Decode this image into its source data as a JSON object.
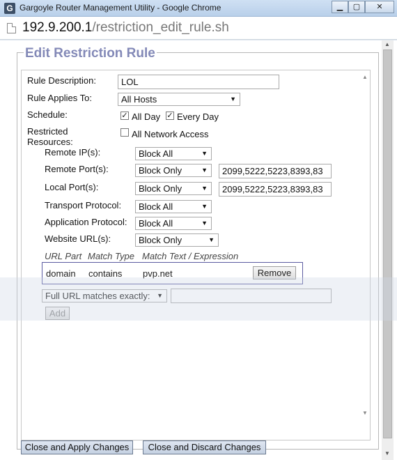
{
  "window": {
    "title": "Gargoyle Router Management Utility - Google Chrome",
    "app_icon": "G",
    "minimize_glyph": "▁",
    "maximize_glyph": "▢",
    "close_glyph": "✕"
  },
  "address": {
    "host": "192.9.200.1",
    "path": "/restriction_edit_rule.sh"
  },
  "form": {
    "title": "Edit Restriction Rule",
    "rule_description_label": "Rule Description:",
    "rule_description_value": "LOL",
    "rule_applies_label": "Rule Applies To:",
    "rule_applies_value": "All Hosts",
    "schedule_label": "Schedule:",
    "all_day_label": "All Day",
    "every_day_label": "Every Day",
    "restricted_label_1": "Restricted",
    "restricted_label_2": "Resources:",
    "all_network_access_label": "All Network Access",
    "remote_ip_label": "Remote IP(s):",
    "remote_ip_value": "Block All",
    "remote_port_label": "Remote Port(s):",
    "remote_port_value": "Block Only",
    "remote_port_list": "2099,5222,5223,8393,83",
    "local_port_label": "Local Port(s):",
    "local_port_value": "Block Only",
    "local_port_list": "2099,5222,5223,8393,83",
    "transport_label": "Transport Protocol:",
    "transport_value": "Block All",
    "application_label": "Application Protocol:",
    "application_value": "Block All",
    "website_label": "Website URL(s):",
    "website_value": "Block Only",
    "url_headers": {
      "part": "URL Part",
      "match": "Match Type",
      "text": "Match Text / Expression"
    },
    "url_row": {
      "part": "domain",
      "match": "contains",
      "text": "pvp.net",
      "remove": "Remove"
    },
    "url_match_select": "Full URL matches exactly:",
    "add_label": "Add",
    "checked_glyph": "✓",
    "dropdown_glyph": "▼"
  },
  "actions": {
    "apply_label": "Close and Apply Changes",
    "discard_label": "Close and Discard Changes"
  },
  "scroll_up_glyph": "▲",
  "scroll_down_glyph": "▼"
}
